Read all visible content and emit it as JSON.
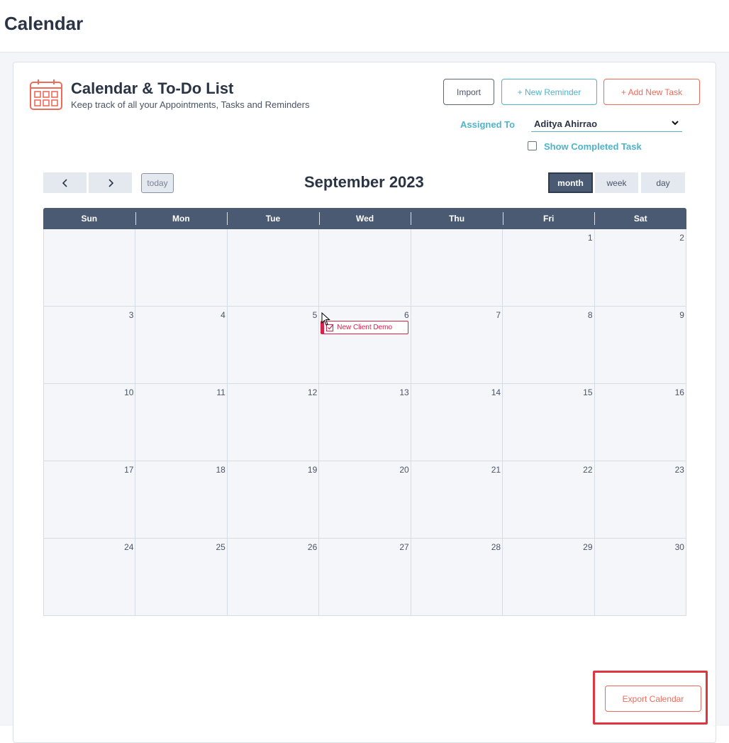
{
  "page": {
    "title": "Calendar"
  },
  "card": {
    "title": "Calendar & To-Do List",
    "subtitle": "Keep track of all your Appointments, Tasks and Reminders",
    "icon": "calendar-icon"
  },
  "actions": {
    "import_label": "Import",
    "new_reminder_label": "+ New Reminder",
    "add_task_label": "+ Add New Task",
    "export_label": "Export Calendar"
  },
  "filters": {
    "assigned_to_label": "Assigned To",
    "assigned_to_value": "Aditya Ahirrao",
    "show_completed_label": "Show Completed Task",
    "show_completed_checked": false
  },
  "toolbar": {
    "today_label": "today",
    "month_title": "September 2023",
    "views": [
      {
        "label": "month",
        "active": true
      },
      {
        "label": "week",
        "active": false
      },
      {
        "label": "day",
        "active": false
      }
    ]
  },
  "weekdays": [
    "Sun",
    "Mon",
    "Tue",
    "Wed",
    "Thu",
    "Fri",
    "Sat"
  ],
  "weeks": [
    [
      "",
      "",
      "",
      "",
      "",
      "1",
      "2"
    ],
    [
      "3",
      "4",
      "5",
      "6",
      "7",
      "8",
      "9"
    ],
    [
      "10",
      "11",
      "12",
      "13",
      "14",
      "15",
      "16"
    ],
    [
      "17",
      "18",
      "19",
      "20",
      "21",
      "22",
      "23"
    ],
    [
      "24",
      "25",
      "26",
      "27",
      "28",
      "29",
      "30"
    ]
  ],
  "events": [
    {
      "title": "New Client Demo",
      "day": "6",
      "icon": "task-check-icon",
      "color": "#d6234a"
    }
  ],
  "colors": {
    "accent_teal": "#4fb3c9",
    "accent_coral": "#ee6b5a",
    "header_navy": "#4a5a73",
    "event_red": "#d6234a",
    "highlight_red": "#e0343f"
  }
}
